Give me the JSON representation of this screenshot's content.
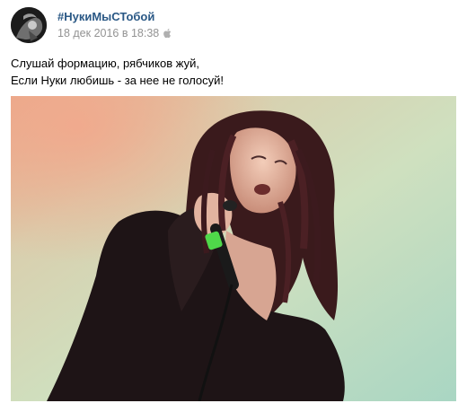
{
  "post": {
    "author": "#НукиМыСТобой",
    "timestamp": "18 дек 2016 в 18:38",
    "platform_icon": "apple-icon",
    "text_lines": [
      "Слушай формацию, рябчиков жуй,",
      "Если Нуки любишь - за нее не голосуй!"
    ],
    "photo": {
      "subject": "singer-with-microphone"
    }
  },
  "colors": {
    "author_link": "#2a5885",
    "meta_text": "#939393"
  }
}
